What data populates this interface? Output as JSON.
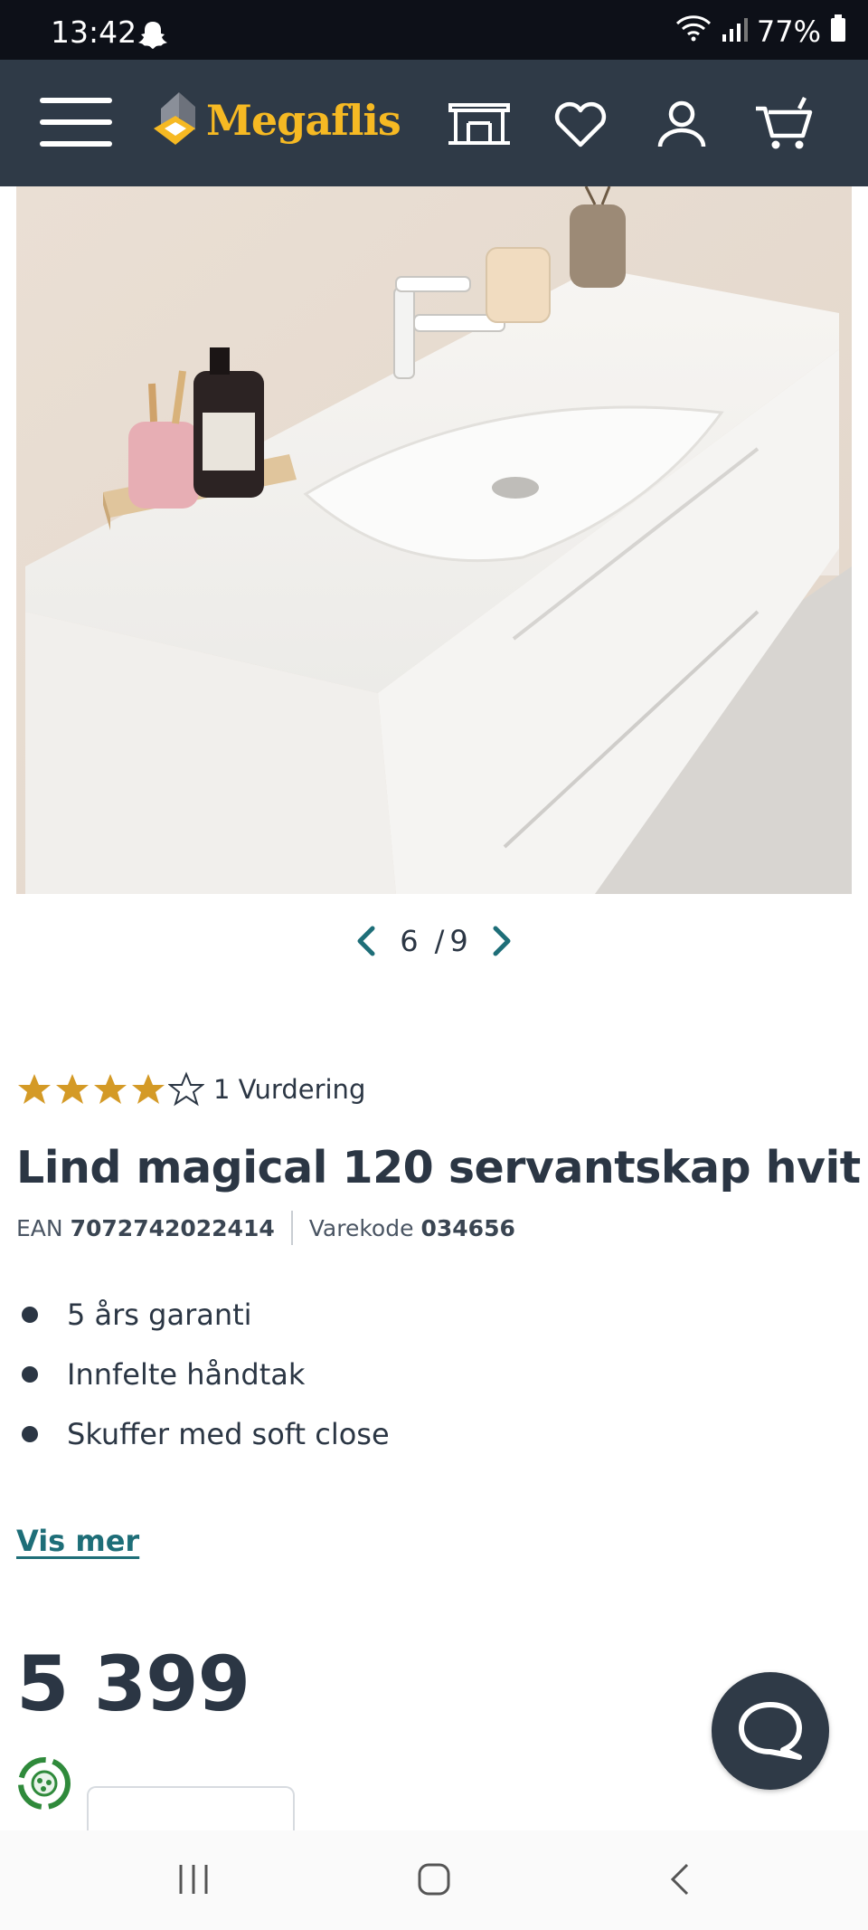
{
  "status_bar": {
    "time": "13:42",
    "battery": "77%"
  },
  "header": {
    "logo_text": "Megaflis",
    "icons": [
      "menu-icon",
      "store-icon",
      "heart-icon",
      "user-icon",
      "cart-icon"
    ],
    "background_color": "#2f3a47",
    "logo_color": "#f6b923"
  },
  "gallery": {
    "current": "6",
    "separator": "/",
    "total": "9"
  },
  "product": {
    "rating": 4,
    "rating_max": 5,
    "review_count": "1 Vurdering",
    "title": "Lind magical 120 servantskap hvit",
    "ean_label": "EAN",
    "ean": "7072742022414",
    "sku_label": "Varekode",
    "sku": "034656",
    "features": [
      "5 års garanti",
      "Innfelte håndtak",
      "Skuffer med soft close"
    ],
    "more_link": "Vis mer",
    "price": "5 399"
  },
  "colors": {
    "accent_link": "#1e6e78",
    "star": "#d49a26",
    "text": "#2b3644"
  }
}
